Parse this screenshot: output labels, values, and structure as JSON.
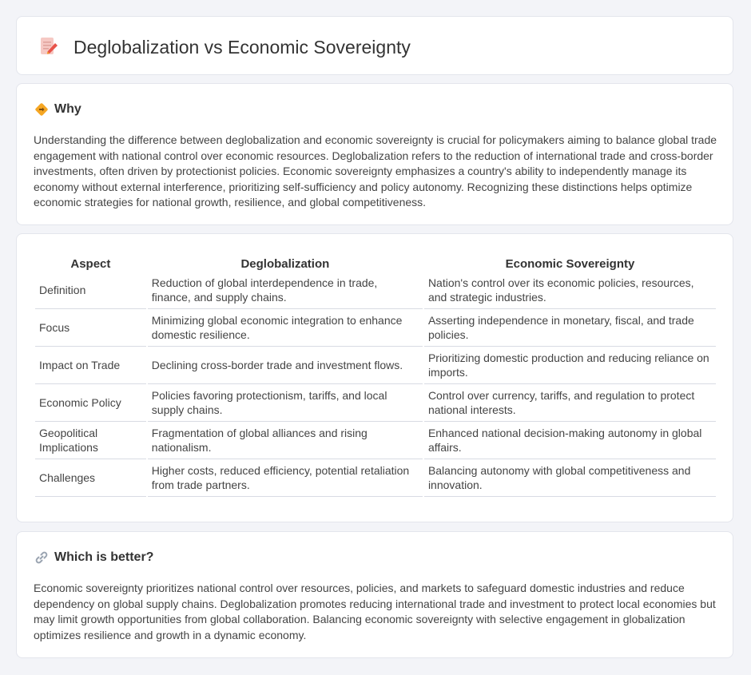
{
  "header": {
    "title": "Deglobalization vs Economic Sovereignty",
    "icon": "document-pen-icon"
  },
  "why": {
    "title": "Why",
    "icon": "diamond-signpost-icon",
    "text": "Understanding the difference between deglobalization and economic sovereignty is crucial for policymakers aiming to balance global trade engagement with national control over economic resources. Deglobalization refers to the reduction of international trade and cross-border investments, often driven by protectionist policies. Economic sovereignty emphasizes a country's ability to independently manage its economy without external interference, prioritizing self-sufficiency and policy autonomy. Recognizing these distinctions helps optimize economic strategies for national growth, resilience, and global competitiveness."
  },
  "table": {
    "headers": [
      "Aspect",
      "Deglobalization",
      "Economic Sovereignty"
    ],
    "rows": [
      [
        "Definition",
        "Reduction of global interdependence in trade, finance, and supply chains.",
        "Nation's control over its economic policies, resources, and strategic industries."
      ],
      [
        "Focus",
        "Minimizing global economic integration to enhance domestic resilience.",
        "Asserting independence in monetary, fiscal, and trade policies."
      ],
      [
        "Impact on Trade",
        "Declining cross-border trade and investment flows.",
        "Prioritizing domestic production and reducing reliance on imports."
      ],
      [
        "Economic Policy",
        "Policies favoring protectionism, tariffs, and local supply chains.",
        "Control over currency, tariffs, and regulation to protect national interests."
      ],
      [
        "Geopolitical Implications",
        "Fragmentation of global alliances and rising nationalism.",
        "Enhanced national decision-making autonomy in global affairs."
      ],
      [
        "Challenges",
        "Higher costs, reduced efficiency, potential retaliation from trade partners.",
        "Balancing autonomy with global competitiveness and innovation."
      ]
    ]
  },
  "better": {
    "title": "Which is better?",
    "icon": "link-icon",
    "text": "Economic sovereignty prioritizes national control over resources, policies, and markets to safeguard domestic industries and reduce dependency on global supply chains. Deglobalization promotes reducing international trade and investment to protect local economies but may limit growth opportunities from global collaboration. Balancing economic sovereignty with selective engagement in globalization optimizes resilience and growth in a dynamic economy."
  },
  "colors": {
    "accent_orange": "#f5a623",
    "link_gray": "#9aa4b1",
    "pen_red": "#e8534a"
  }
}
